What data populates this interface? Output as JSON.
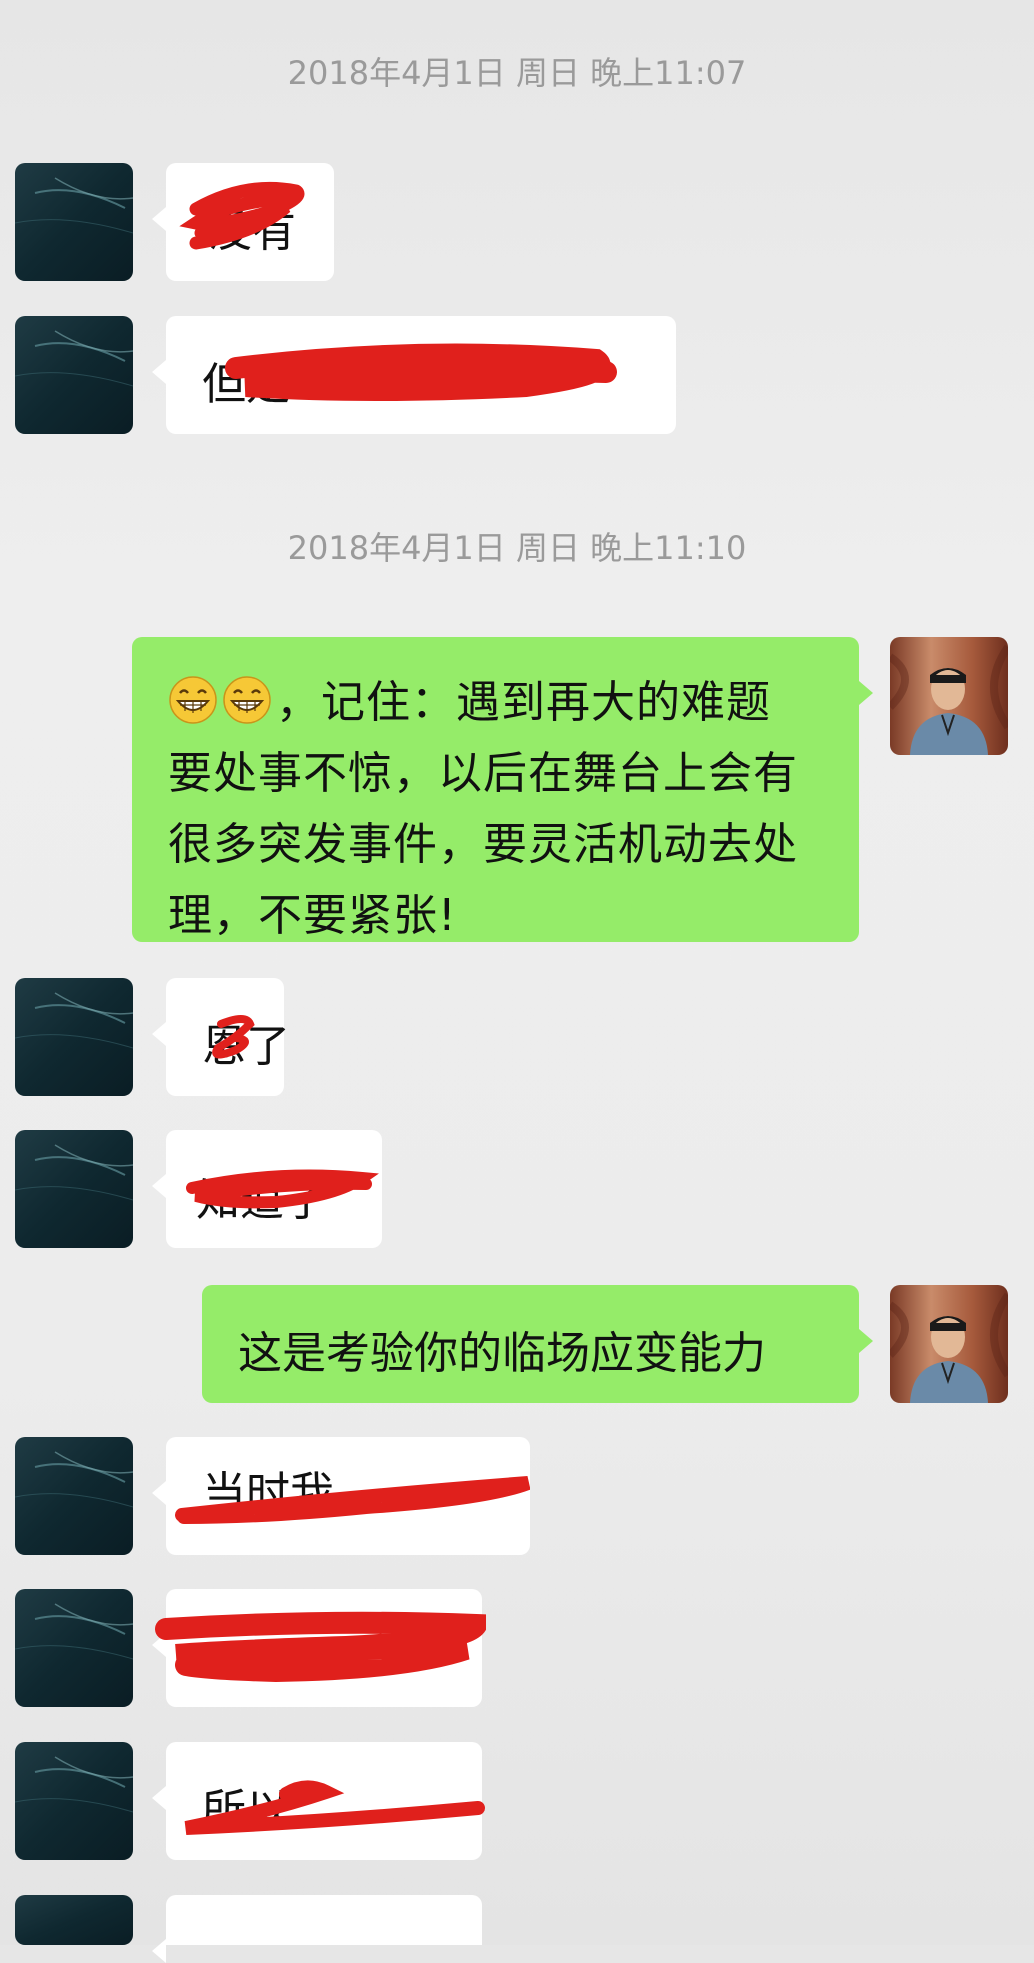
{
  "timestamps": [
    "2018年4月1日 周日 晚上11:07",
    "2018年4月1日 周日 晚上11:10"
  ],
  "messages": {
    "m1": {
      "text": "没有"
    },
    "m2": {
      "text": "但是"
    },
    "m3": {
      "text": "，记住：遇到再大的难题要处事不惊，以后在舞台上会有很多突发事件，要灵活机动去处理，不要紧张!",
      "emoji": "grin-emoji"
    },
    "m4": {
      "text": "恩了"
    },
    "m5": {
      "text": "知道了"
    },
    "m6": {
      "text": "这是考验你的临场应变能力"
    },
    "m7": {
      "text": "当时我"
    },
    "m8": {
      "text": ""
    },
    "m9": {
      "text": "所以"
    }
  },
  "colors": {
    "right_bubble": "#95ec69",
    "left_bubble": "#ffffff",
    "redaction": "#e0201c",
    "timestamp": "#9a9a9a"
  }
}
